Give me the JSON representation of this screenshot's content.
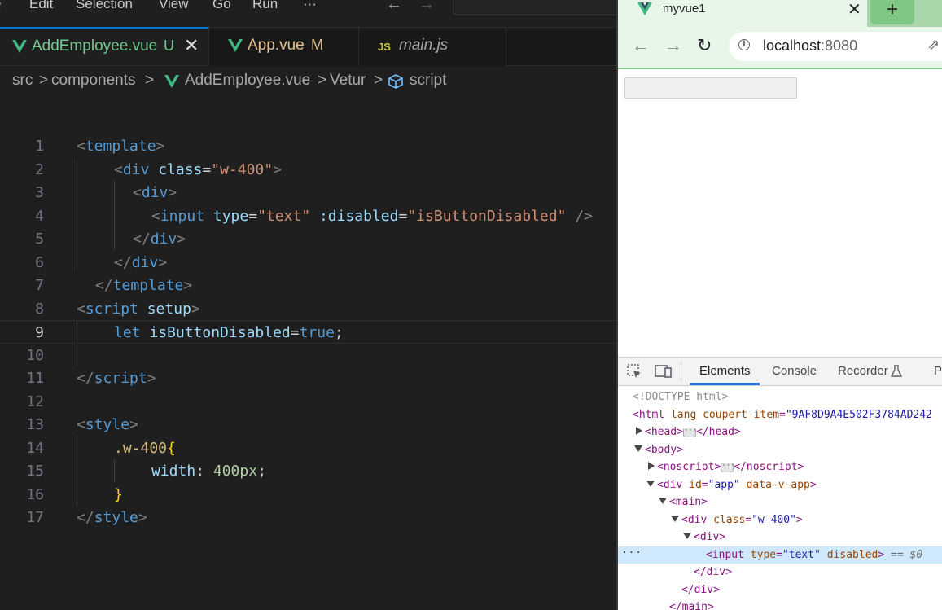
{
  "vscode": {
    "menu": [
      "e",
      "Edit",
      "Selection",
      "View",
      "Go",
      "Run",
      "···"
    ],
    "tabs": [
      {
        "label": "AddEmployee.vue",
        "badge": "U",
        "close": "✕",
        "active": true,
        "color": "#73c991"
      },
      {
        "label": "App.vue",
        "badge": "M",
        "active": false,
        "color": "#e2c08d"
      },
      {
        "label": "main.js",
        "icon": "JS",
        "active": false,
        "color": "#a9a9a9"
      }
    ],
    "breadcrumb": [
      "src",
      "components",
      "AddEmployee.vue",
      "Vetur",
      "script"
    ],
    "breadcrumb_sep": ">",
    "line_numbers": [
      "1",
      "2",
      "3",
      "4",
      "5",
      "6",
      "7",
      "8",
      "9",
      "10",
      "11",
      "12",
      "13",
      "14",
      "15",
      "16",
      "17"
    ],
    "code": {
      "l1": {
        "br1": "<",
        "tag": "template",
        "br2": ">"
      },
      "l2": {
        "br1": "<",
        "tag": "div",
        "attr": "class",
        "eq": "=",
        "val": "\"w-400\"",
        "br2": ">"
      },
      "l3": {
        "br1": "<",
        "tag": "div",
        "br2": ">"
      },
      "l4": {
        "br1": "<",
        "tag": "input",
        "attr1": "type",
        "eq1": "=",
        "val1": "\"text\"",
        "attr2": ":disabled",
        "eq2": "=",
        "val2": "\"isButtonDisabled\"",
        "tail": "/>"
      },
      "l5": {
        "br1": "</",
        "tag": "div",
        "br2": ">"
      },
      "l6": {
        "br1": "</",
        "tag": "div",
        "br2": ">"
      },
      "l7": {
        "br1": "</",
        "tag": "template",
        "br2": ">"
      },
      "l8": {
        "br1": "<",
        "tag": "script",
        "attr": "setup",
        "br2": ">"
      },
      "l9": {
        "kw": "let",
        "var": "isButtonDisabled",
        "eq": "=",
        "val": "true",
        "semi": ";"
      },
      "l11": {
        "br1": "</",
        "tag": "script",
        "br2": ">"
      },
      "l13": {
        "br1": "<",
        "tag": "style",
        "br2": ">"
      },
      "l14": {
        "sel": ".w-400",
        "brace": "{"
      },
      "l15": {
        "prop": "width",
        "colon": ":",
        "val": "400px",
        "semi": ";"
      },
      "l16": {
        "brace": "}"
      },
      "l17": {
        "br1": "</",
        "tag": "style",
        "br2": ">"
      }
    }
  },
  "browser": {
    "tab_title": "myvue1",
    "tab_close": "✕",
    "new_tab": "+",
    "back": "←",
    "forward": "→",
    "reload": "↻",
    "url_host": "localhost",
    "url_port": ":8080",
    "share": "⇗",
    "devtools": {
      "tabs": [
        "Elements",
        "Console",
        "Recorder",
        "P"
      ],
      "active_tab": "Elements",
      "dom": {
        "doctype": "<!DOCTYPE html>",
        "html_open": "<html",
        "html_attr": "lang",
        "html_attr2": "coupert-item",
        "html_val2": "\"9AF8D9A4E502F3784AD242",
        "head_open": "<head>",
        "head_close": "</head>",
        "body": "<body>",
        "noscript_open": "<noscript>",
        "noscript_close": "</noscript>",
        "app_open": "<div",
        "app_attr": "id",
        "app_val": "\"app\"",
        "app_attr2": "data-v-app",
        "app_close": ">",
        "main": "<main>",
        "w400_open": "<div",
        "w400_attr": "class",
        "w400_val": "\"w-400\"",
        "w400_close": ">",
        "div": "<div>",
        "input_open": "<input",
        "input_attr": "type",
        "input_val": "\"text\"",
        "input_attr2": "disabled",
        "input_close": ">",
        "eq_ref": "== $0",
        "div_close": "</div>",
        "div_close2": "</div>",
        "main_close": "</main>",
        "ellipsis": "···"
      }
    }
  }
}
